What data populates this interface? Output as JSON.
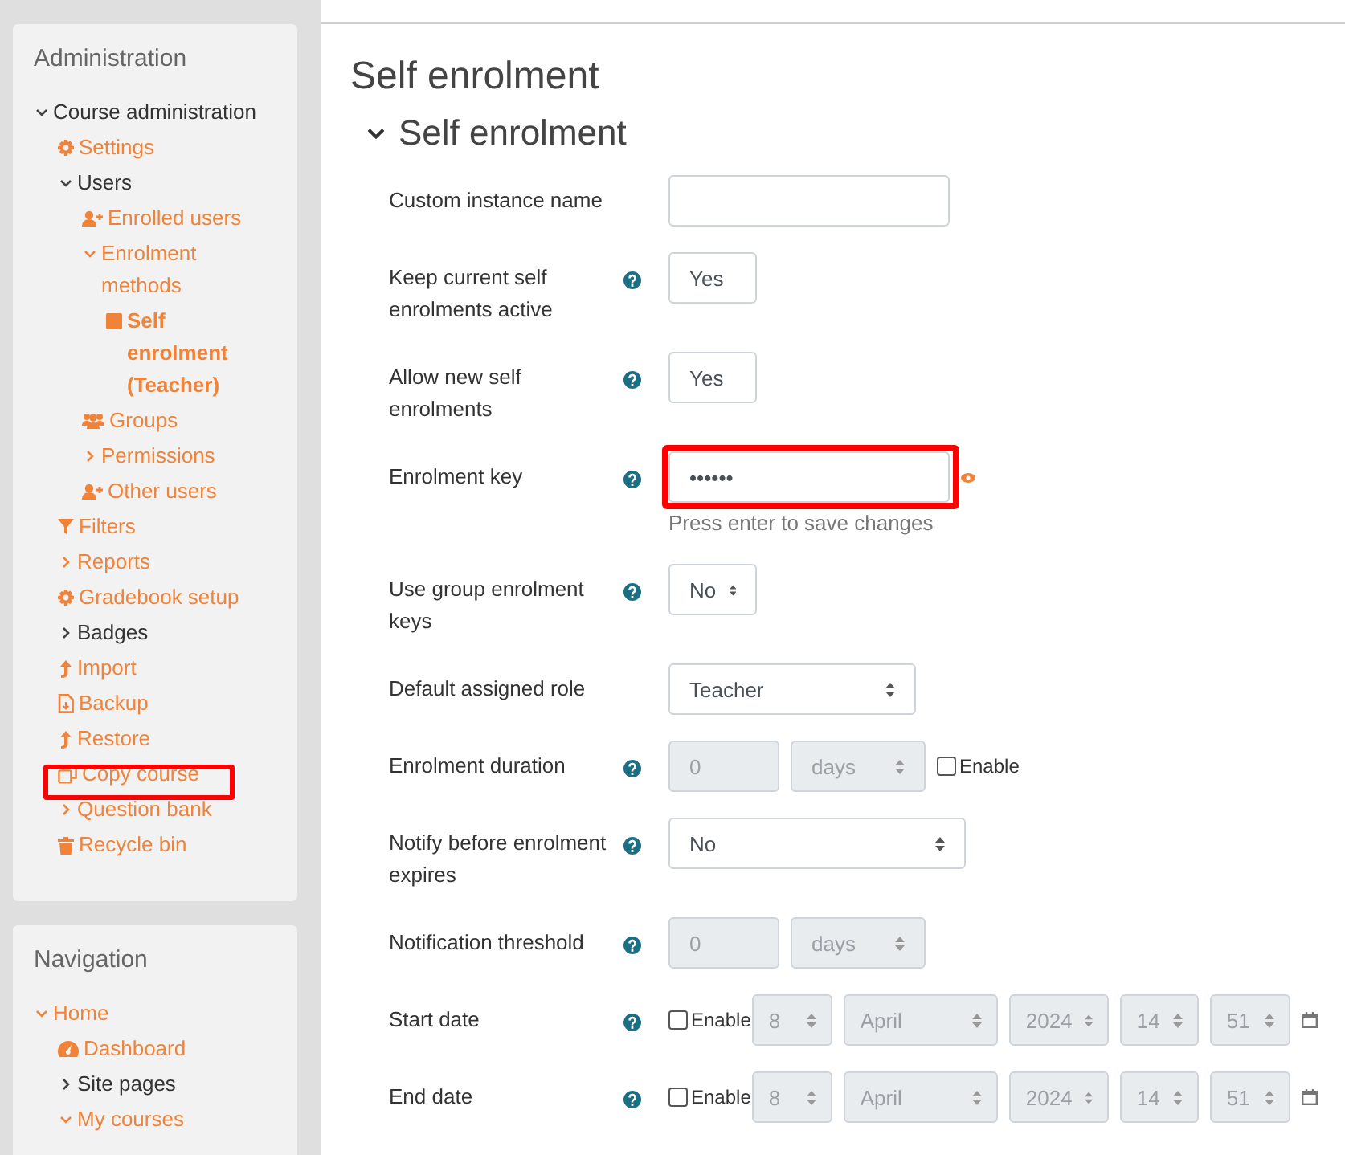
{
  "sidebar": {
    "blocks": [
      {
        "title": "Administration",
        "items": [
          {
            "label": "Course administration",
            "expanded": true,
            "link": false,
            "selected": false,
            "children": [
              {
                "label": "Settings",
                "kind": "gear",
                "link": true,
                "selected": false
              },
              {
                "label": "Users",
                "expanded": true,
                "link": false,
                "selected": false,
                "children": [
                  {
                    "label": "Enrolled users",
                    "kind": "user-plus",
                    "link": true,
                    "selected": false
                  },
                  {
                    "label": "Enrolment methods",
                    "expanded": true,
                    "link": true,
                    "selected": false,
                    "children": [
                      {
                        "label": "Self enrolment (Teacher)",
                        "kind": "square",
                        "link": true,
                        "selected": true
                      }
                    ]
                  },
                  {
                    "label": "Groups",
                    "kind": "users",
                    "link": true,
                    "selected": false
                  },
                  {
                    "label": "Permissions",
                    "expanded": false,
                    "link": true,
                    "selected": false
                  },
                  {
                    "label": "Other users",
                    "kind": "user-plus",
                    "link": true,
                    "selected": false
                  }
                ]
              },
              {
                "label": "Filters",
                "kind": "filter",
                "link": true,
                "selected": false
              },
              {
                "label": "Reports",
                "expanded": false,
                "link": true,
                "selected": false
              },
              {
                "label": "Gradebook setup",
                "kind": "gear",
                "link": true,
                "selected": false
              },
              {
                "label": "Badges",
                "expanded": false,
                "link": false,
                "selected": false
              },
              {
                "label": "Import",
                "kind": "upload",
                "link": true,
                "selected": false
              },
              {
                "label": "Backup",
                "kind": "file",
                "link": true,
                "selected": false
              },
              {
                "label": "Restore",
                "kind": "upload",
                "link": true,
                "selected": false
              },
              {
                "label": "Copy course",
                "kind": "copy",
                "link": true,
                "selected": false,
                "highlighted": true
              },
              {
                "label": "Question bank",
                "expanded": false,
                "link": true,
                "selected": false
              },
              {
                "label": "Recycle bin",
                "kind": "trash",
                "link": true,
                "selected": false
              }
            ]
          }
        ]
      },
      {
        "title": "Navigation",
        "items": [
          {
            "label": "Home",
            "expanded": true,
            "link": true,
            "selected": false,
            "children": [
              {
                "label": "Dashboard",
                "kind": "gauge",
                "link": true,
                "selected": false
              },
              {
                "label": "Site pages",
                "expanded": false,
                "link": false,
                "selected": false
              },
              {
                "label": "My courses",
                "expanded": true,
                "link": true,
                "selected": false
              }
            ]
          }
        ]
      }
    ]
  },
  "page": {
    "title": "Self enrolment",
    "section": {
      "title": "Self enrolment",
      "expanded": true
    },
    "fields": [
      {
        "label": "Custom instance name",
        "help": false,
        "kind": "text"
      },
      {
        "label": "Keep current self enrolments active",
        "help": true,
        "kind": "select",
        "value": "Yes"
      },
      {
        "label": "Allow new self enrolments",
        "help": true,
        "kind": "select",
        "value": "Yes"
      },
      {
        "label": "Enrolment key",
        "help": true,
        "kind": "password",
        "value": "••••••",
        "hint": "Press enter to save changes",
        "highlighted": true
      },
      {
        "label": "Use group enrolment keys",
        "help": true,
        "kind": "select",
        "value": "No"
      },
      {
        "label": "Default assigned role",
        "help": false,
        "kind": "select",
        "value": "Teacher"
      },
      {
        "label": "Enrolment duration",
        "help": true,
        "kind": "duration",
        "value": "0",
        "unit": "days",
        "disabled": true,
        "enable": {
          "label": "Enable",
          "checked": false
        }
      },
      {
        "label": "Notify before enrolment expires",
        "help": true,
        "kind": "select",
        "value": "No"
      },
      {
        "label": "Notification threshold",
        "help": true,
        "kind": "duration",
        "value": "0",
        "unit": "days",
        "disabled": true
      },
      {
        "label": "Start date",
        "help": true,
        "kind": "date",
        "disabled": true,
        "enable": {
          "label": "Enable",
          "checked": false
        },
        "parts": [
          "8",
          "April",
          "2024",
          "14",
          "51"
        ]
      },
      {
        "label": "End date",
        "help": true,
        "kind": "date",
        "disabled": true,
        "enable": {
          "label": "Enable",
          "checked": false
        },
        "parts": [
          "8",
          "April",
          "2024",
          "14",
          "51"
        ]
      }
    ]
  }
}
